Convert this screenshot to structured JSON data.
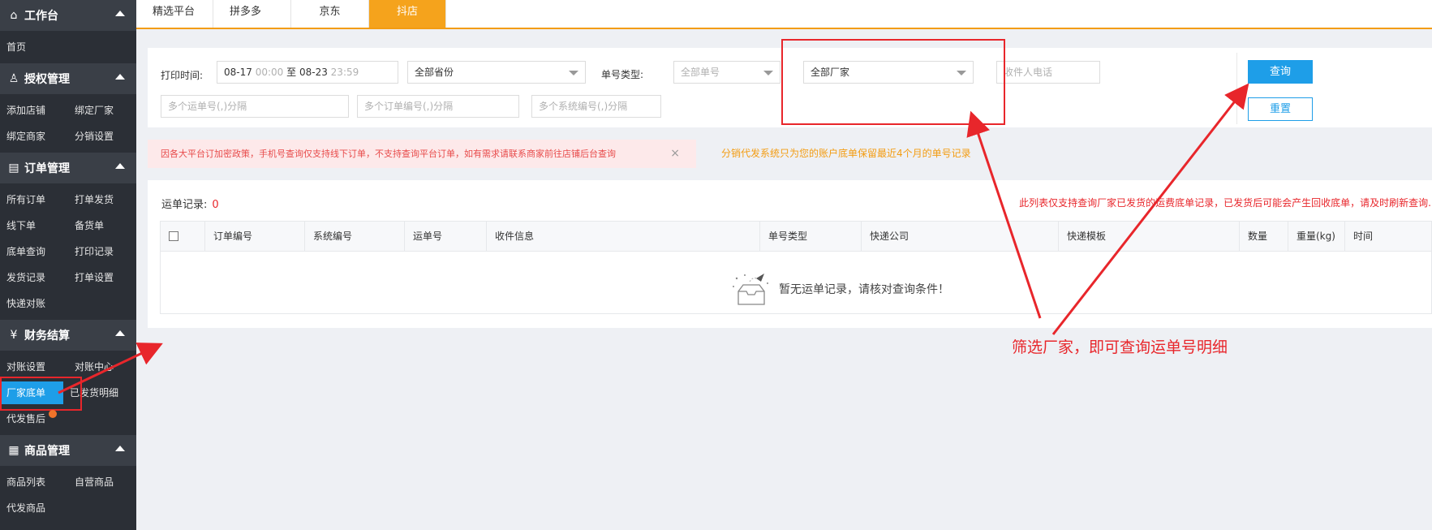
{
  "sidebar": {
    "sections": [
      {
        "title": "工作台",
        "icon": "home-icon",
        "items": [
          "首页"
        ]
      },
      {
        "title": "授权管理",
        "icon": "user-auth-icon",
        "items": [
          "添加店铺",
          "绑定厂家",
          "绑定商家",
          "分销设置"
        ]
      },
      {
        "title": "订单管理",
        "icon": "order-list-icon",
        "items": [
          "所有订单",
          "打单发货",
          "线下单",
          "备货单",
          "底单查询",
          "打印记录",
          "发货记录",
          "打单设置",
          "快递对账"
        ]
      },
      {
        "title": "财务结算",
        "icon": "yen-icon",
        "items": [
          "对账设置",
          "对账中心",
          "厂家底单",
          "已发货明细",
          "代发售后"
        ],
        "active": "厂家底单"
      },
      {
        "title": "商品管理",
        "icon": "grid-icon",
        "items": [
          "商品列表",
          "自营商品",
          "代发商品"
        ]
      }
    ]
  },
  "tabs": [
    "精选平台",
    "拼多多",
    "京东",
    "抖店"
  ],
  "active_tab": "抖店",
  "filter": {
    "print_time_label": "打印时间:",
    "date_from": "08-17",
    "time_from": "00:00",
    "range_sep": "至",
    "date_to": "08-23",
    "time_to": "23:59",
    "province": "全部省份",
    "order_type_label": "单号类型:",
    "order_type_placeholder": "全部单号",
    "factory": "全部厂家",
    "phone_placeholder": "收件人电话",
    "waybill_placeholder": "多个运单号(,)分隔",
    "order_no_placeholder": "多个订单编号(,)分隔",
    "system_no_placeholder": "多个系统编号(,)分隔",
    "query_btn": "查询",
    "reset_btn": "重置"
  },
  "notices": {
    "red": "因各大平台订加密政策，手机号查询仅支持线下订单，不支持查询平台订单，如有需求请联系商家前往店铺后台查询",
    "close": "×",
    "orange": "分销代发系统只为您的账户底单保留最近4个月的单号记录"
  },
  "records": {
    "title": "运单记录:",
    "count": "0",
    "note": "此列表仅支持查询厂家已发货的运费底单记录，已发货后可能会产生回收底单，请及时刷新查询.",
    "columns": [
      "订单编号",
      "系统编号",
      "运单号",
      "收件信息",
      "单号类型",
      "快递公司",
      "快递模板",
      "数量",
      "重量(kg)",
      "时间"
    ],
    "empty": "暂无运单记录，请核对查询条件！"
  },
  "annotation": {
    "text": "筛选厂家，即可查询运单号明细",
    "color": "#e8262b"
  }
}
